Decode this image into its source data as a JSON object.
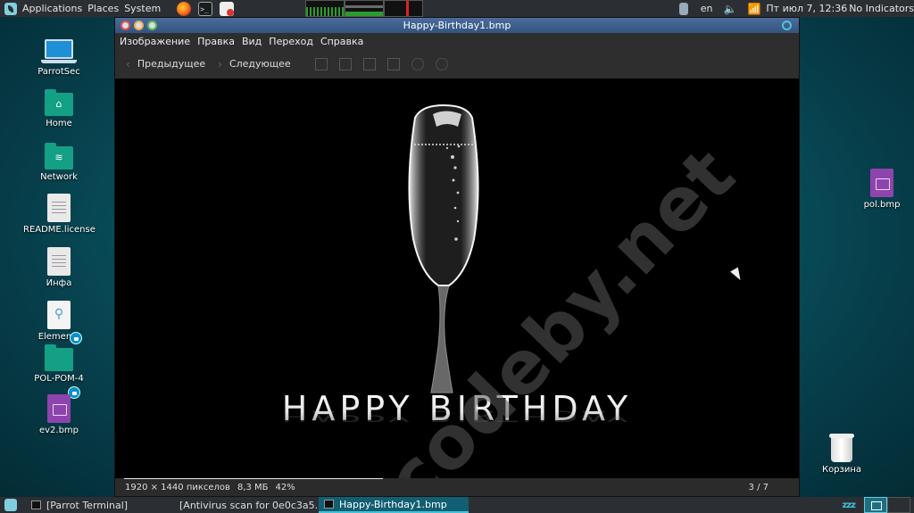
{
  "top_panel": {
    "menus": [
      "Applications",
      "Places",
      "System"
    ],
    "language": "en",
    "clock": "Пт июл  7, 12:36",
    "indicators": "No Indicators"
  },
  "desktop": {
    "icons_left": [
      {
        "label": "ParrotSec",
        "icon": "laptop-icon"
      },
      {
        "label": "Home",
        "icon": "home-folder-icon"
      },
      {
        "label": "Network",
        "icon": "network-folder-icon"
      },
      {
        "label": "README.license",
        "icon": "text-file-icon"
      },
      {
        "label": "Инфа",
        "icon": "text-file-icon"
      },
      {
        "label": "Elements",
        "icon": "usb-drive-icon"
      },
      {
        "label": "POL-POM-4",
        "icon": "folder-icon"
      },
      {
        "label": "ev2.bmp",
        "icon": "image-file-icon"
      }
    ],
    "icon_right": {
      "label": "pol.bmp",
      "icon": "image-file-icon"
    },
    "trash": {
      "label": "Корзина",
      "icon": "trash-icon"
    }
  },
  "viewer": {
    "title": "Happy-Birthday1.bmp",
    "menu": [
      "Изображение",
      "Правка",
      "Вид",
      "Переход",
      "Справка"
    ],
    "toolbar": {
      "prev_label": "Предыдущее",
      "next_label": "Следующее"
    },
    "image": {
      "caption": "HAPPY BIRTHDAY",
      "watermark": "codeby.net"
    },
    "status": {
      "dimensions": "1920 × 1440 пикселов",
      "size": "8,3 МБ",
      "zoom": "42%",
      "page": "3 / 7"
    }
  },
  "taskbar": {
    "tasks": [
      {
        "label": "[Parrot Terminal]",
        "icon": "terminal-icon",
        "active": false
      },
      {
        "label": "[Antivirus scan for 0e0c3a5...",
        "icon": "firefox-icon",
        "active": false
      },
      {
        "label": "Happy-Birthday1.bmp",
        "icon": "image-viewer-icon",
        "active": true
      }
    ],
    "sleep_indicator": "zzz"
  }
}
